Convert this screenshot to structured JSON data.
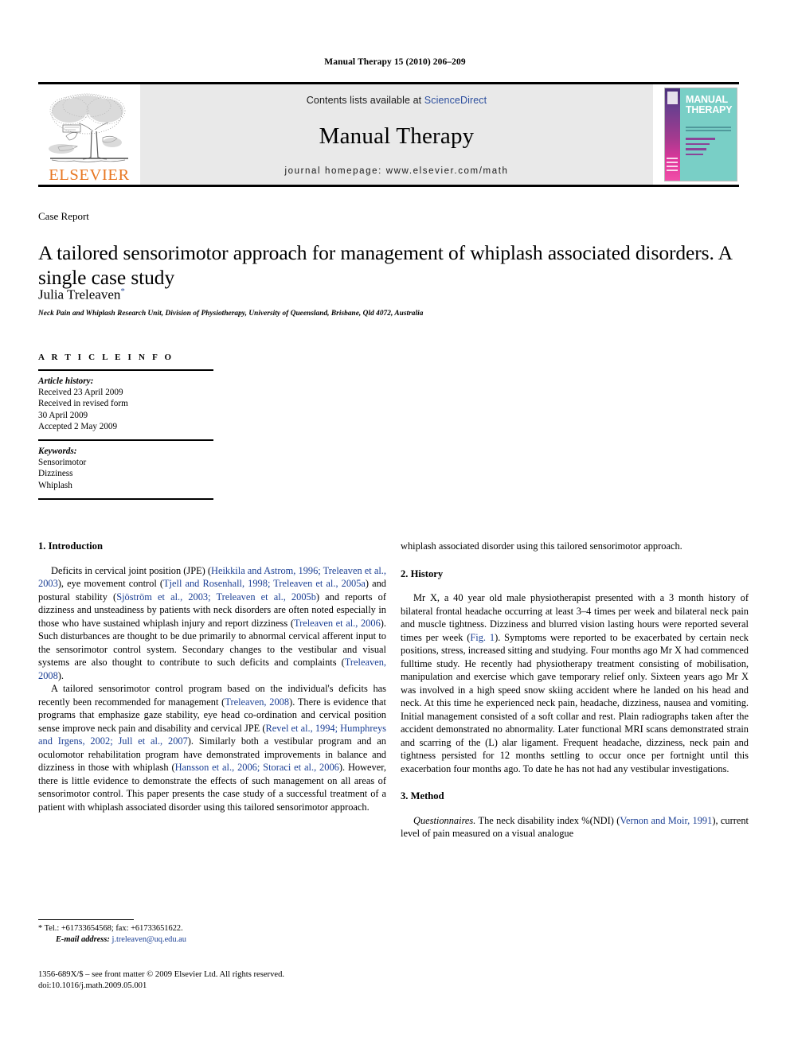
{
  "running_head": "Manual Therapy 15 (2010) 206–209",
  "header": {
    "contents_prefix": "Contents lists available at ",
    "sciencedirect": "ScienceDirect",
    "journal_name": "Manual Therapy",
    "homepage": "journal homepage: www.elsevier.com/math",
    "publisher_logo_text": "ELSEVIER",
    "cover": {
      "title_line1": "MANUAL",
      "title_line2": "THERAPY"
    },
    "accent_orange": "#E87722",
    "link_blue": "#2d4f9e",
    "band_gray": "#e9e9e9"
  },
  "article": {
    "type": "Case Report",
    "title": "A tailored sensorimotor approach for management of whiplash associated disorders. A single case study",
    "author": "Julia Treleaven",
    "author_marker": "*",
    "affiliation": "Neck Pain and Whiplash Research Unit, Division of Physiotherapy, University of Queensland, Brisbane, Qld 4072, Australia"
  },
  "article_info": {
    "heading": "A R T I C L E   I N F O",
    "history_label": "Article history:",
    "history_lines": [
      "Received 23 April 2009",
      "Received in revised form",
      "30 April 2009",
      "Accepted 2 May 2009"
    ],
    "keywords_label": "Keywords:",
    "keywords": [
      "Sensorimotor",
      "Dizziness",
      "Whiplash"
    ]
  },
  "sections": {
    "introduction_heading": "1. Introduction",
    "history_heading": "2. History",
    "method_heading": "3. Method"
  },
  "body": {
    "intro_p1_a": "Deficits in cervical joint position (JPE) (",
    "intro_p1_ref1": "Heikkila and Astrom, 1996; Treleaven et al., 2003",
    "intro_p1_b": "), eye movement control (",
    "intro_p1_ref2": "Tjell and Rosenhall, 1998; Treleaven et al., 2005a",
    "intro_p1_c": ") and postural stability (",
    "intro_p1_ref3": "Sjöström et al., 2003; Treleaven et al., 2005b",
    "intro_p1_d": ") and reports of dizziness and unsteadiness by patients with neck disorders are often noted especially in those who have sustained whiplash injury and report dizziness (",
    "intro_p1_ref4": "Treleaven et al., 2006",
    "intro_p1_e": "). Such disturbances are thought to be due primarily to abnormal cervical afferent input to the sensorimotor control system. Secondary changes to the vestibular and visual systems are also thought to contribute to such deficits and complaints (",
    "intro_p1_ref5": "Treleaven, 2008",
    "intro_p1_f": ").",
    "intro_p2_a": "A tailored sensorimotor control program based on the individual's deficits has recently been recommended for management (",
    "intro_p2_ref1": "Treleaven, 2008",
    "intro_p2_b": "). There is evidence that programs that emphasize gaze stability, eye head co-ordination and cervical position sense improve neck pain and disability and cervical JPE (",
    "intro_p2_ref2": "Revel et al., 1994; Humphreys and Irgens, 2002; Jull et al., 2007",
    "intro_p2_c": "). Similarly both a vestibular program and an oculomotor rehabilitation program have demonstrated improvements in balance and dizziness in those with whiplash (",
    "intro_p2_ref3": "Hansson et al., 2006; Storaci et al., 2006",
    "intro_p2_d": "). However, there is little evidence to demonstrate the effects of such management on all areas of sensorimotor control. This paper presents the case study of a successful treatment of a patient with whiplash associated disorder using this tailored sensorimotor approach.",
    "history_p1_a": "Mr X, a 40 year old male physiotherapist presented with a 3 month history of bilateral frontal headache occurring at least 3–4 times per week and bilateral neck pain and muscle tightness. Dizziness and blurred vision lasting hours were reported several times per week (",
    "history_p1_fig": "Fig. 1",
    "history_p1_b": "). Symptoms were reported to be exacerbated by certain neck positions, stress, increased sitting and studying. Four months ago Mr X had commenced fulltime study. He recently had physiotherapy treatment consisting of mobilisation, manipulation and exercise which gave temporary relief only. Sixteen years ago Mr X was involved in a high speed snow skiing accident where he landed on his head and neck. At this time he experienced neck pain, headache, dizziness, nausea and vomiting. Initial management consisted of a soft collar and rest. Plain radiographs taken after the accident demonstrated no abnormality. Later functional MRI scans demonstrated strain and scarring of the (L) alar ligament. Frequent headache, dizziness, neck pain and tightness persisted for 12 months settling to occur once per fortnight until this exacerbation four months ago. To date he has not had any vestibular investigations.",
    "method_p1_runin": "Questionnaires.",
    "method_p1_a": " The neck disability index %(NDI) (",
    "method_p1_ref1": "Vernon and Moir, 1991",
    "method_p1_b": "), current level of pain measured on a visual analogue"
  },
  "footnote": {
    "marker": "*",
    "tel_fax": "Tel.: +61733654568; fax: +61733651622.",
    "email_label": "E-mail address:",
    "email": "j.treleaven@uq.edu.au"
  },
  "imprint": {
    "line1": "1356-689X/$ – see front matter © 2009 Elsevier Ltd. All rights reserved.",
    "line2": "doi:10.1016/j.math.2009.05.001"
  }
}
